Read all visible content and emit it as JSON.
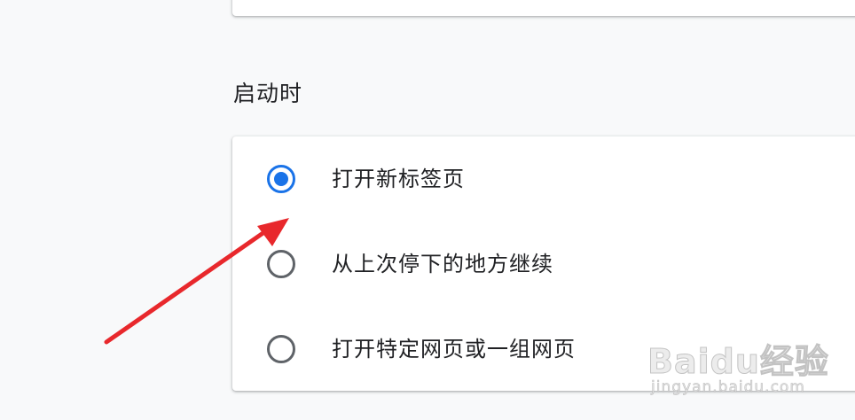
{
  "startup": {
    "title": "启动时",
    "options": [
      {
        "label": "打开新标签页",
        "checked": true
      },
      {
        "label": "从上次停下的地方继续",
        "checked": false
      },
      {
        "label": "打开特定网页或一组网页",
        "checked": false
      }
    ]
  },
  "watermark": {
    "main": "Baidu经验",
    "sub": "jingyan.baidu.com"
  },
  "colors": {
    "accent": "#1a73e8",
    "arrow": "#e8282c",
    "background": "#f8f9fa"
  }
}
